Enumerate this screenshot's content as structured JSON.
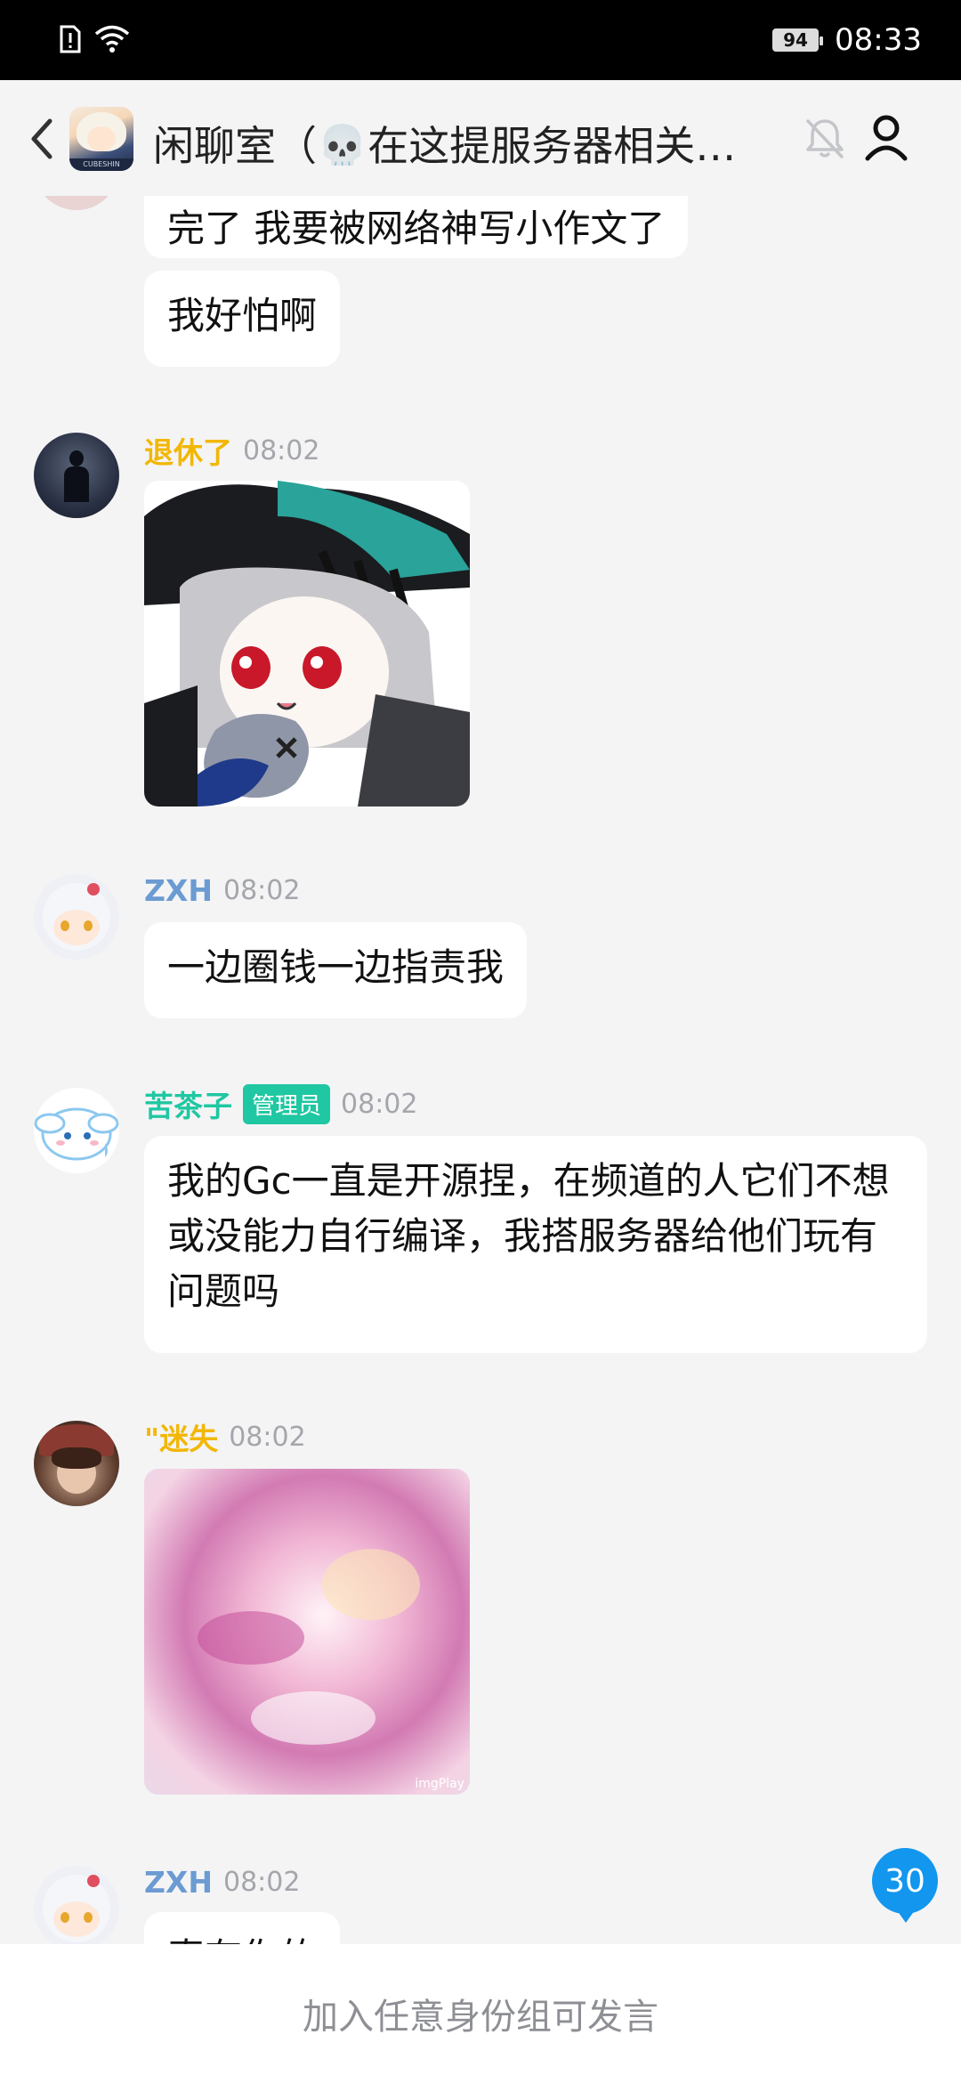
{
  "status_bar": {
    "battery": "94",
    "time": "08:33"
  },
  "header": {
    "title": "闲聊室（💀在这提服务器相关问题的会被禁言）",
    "avatar_label": "CUBESHIN"
  },
  "messages": [
    {
      "type": "text",
      "text": "完了 我要被网络神写小作文了"
    },
    {
      "type": "text",
      "text": "我好怕啊"
    },
    {
      "type": "image",
      "sender": "退休了",
      "sender_color": "#f2b705",
      "time": "08:02"
    },
    {
      "type": "text",
      "sender": "ZXH",
      "sender_color": "#6b9bd2",
      "time": "08:02",
      "text": "一边圈钱一边指责我"
    },
    {
      "type": "text",
      "sender": "苦茶子",
      "sender_color": "#1fc7a2",
      "badge": "管理员",
      "time": "08:02",
      "text": "我的Gc一直是开源捏，在频道的人它们不想或没能力自行编译，我搭服务器给他们玩有问题吗"
    },
    {
      "type": "image",
      "sender": "\"迷失",
      "sender_color": "#f2b705",
      "time": "08:02",
      "watermark": "imgPlay"
    },
    {
      "type": "text",
      "sender": "ZXH",
      "sender_color": "#6b9bd2",
      "time": "08:02",
      "text": "真有你的"
    }
  ],
  "unread_count": "30",
  "footer": {
    "prompt": "加入任意身份组可发言"
  },
  "colors": {
    "accent_blue": "#1296ee",
    "admin_badge": "#1fc7a2",
    "background": "#f4f4f5"
  }
}
